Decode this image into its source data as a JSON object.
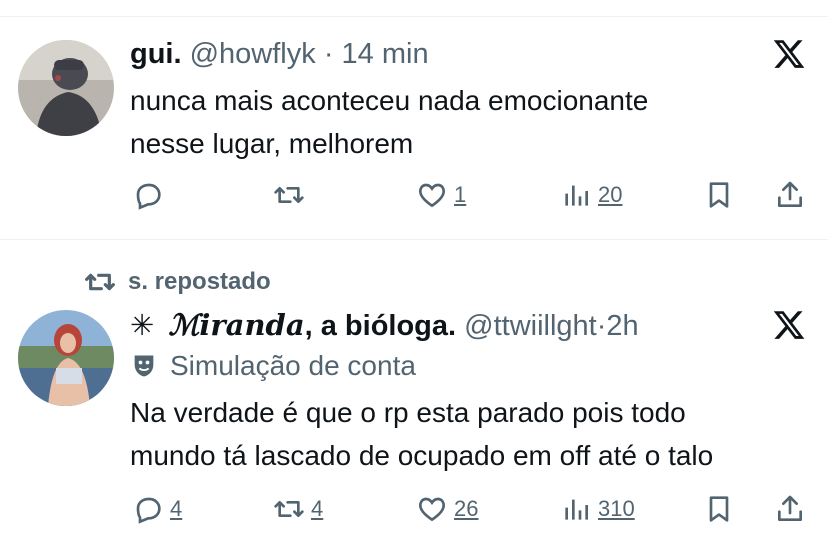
{
  "tweets": [
    {
      "author_name": "gui.",
      "handle": "@howflyk",
      "separator": "·",
      "time": "14 min",
      "text_line1": "nunca mais aconteceu nada emocionante",
      "text_line2": "nesse lugar, melhorem",
      "likes": "1",
      "views": "20"
    },
    {
      "reposted_by": "s. repostado",
      "author_name_prefix": "✳︎",
      "author_name_script": "ℳiranda",
      "author_name_rest": ", a bióloga.",
      "handle": "@ttwiillght",
      "separator": "·",
      "time": "2h",
      "account_label": "Simulação de conta",
      "text_line1": "Na verdade é que o rp esta parado pois todo",
      "text_line2": "mundo tá lascado de ocupado em off até o talo",
      "replies": "4",
      "reposts": "4",
      "likes": "26",
      "views": "310"
    }
  ],
  "icons": {
    "reply": "reply-icon",
    "repost": "repost-icon",
    "like": "heart-icon",
    "views": "views-chart-icon",
    "bookmark": "bookmark-icon",
    "share": "share-icon",
    "platform": "x-logo-icon",
    "parody": "theater-mask-icon"
  },
  "colors": {
    "text_primary": "#0f1419",
    "text_secondary": "#536471",
    "divider": "#eff3f4"
  }
}
